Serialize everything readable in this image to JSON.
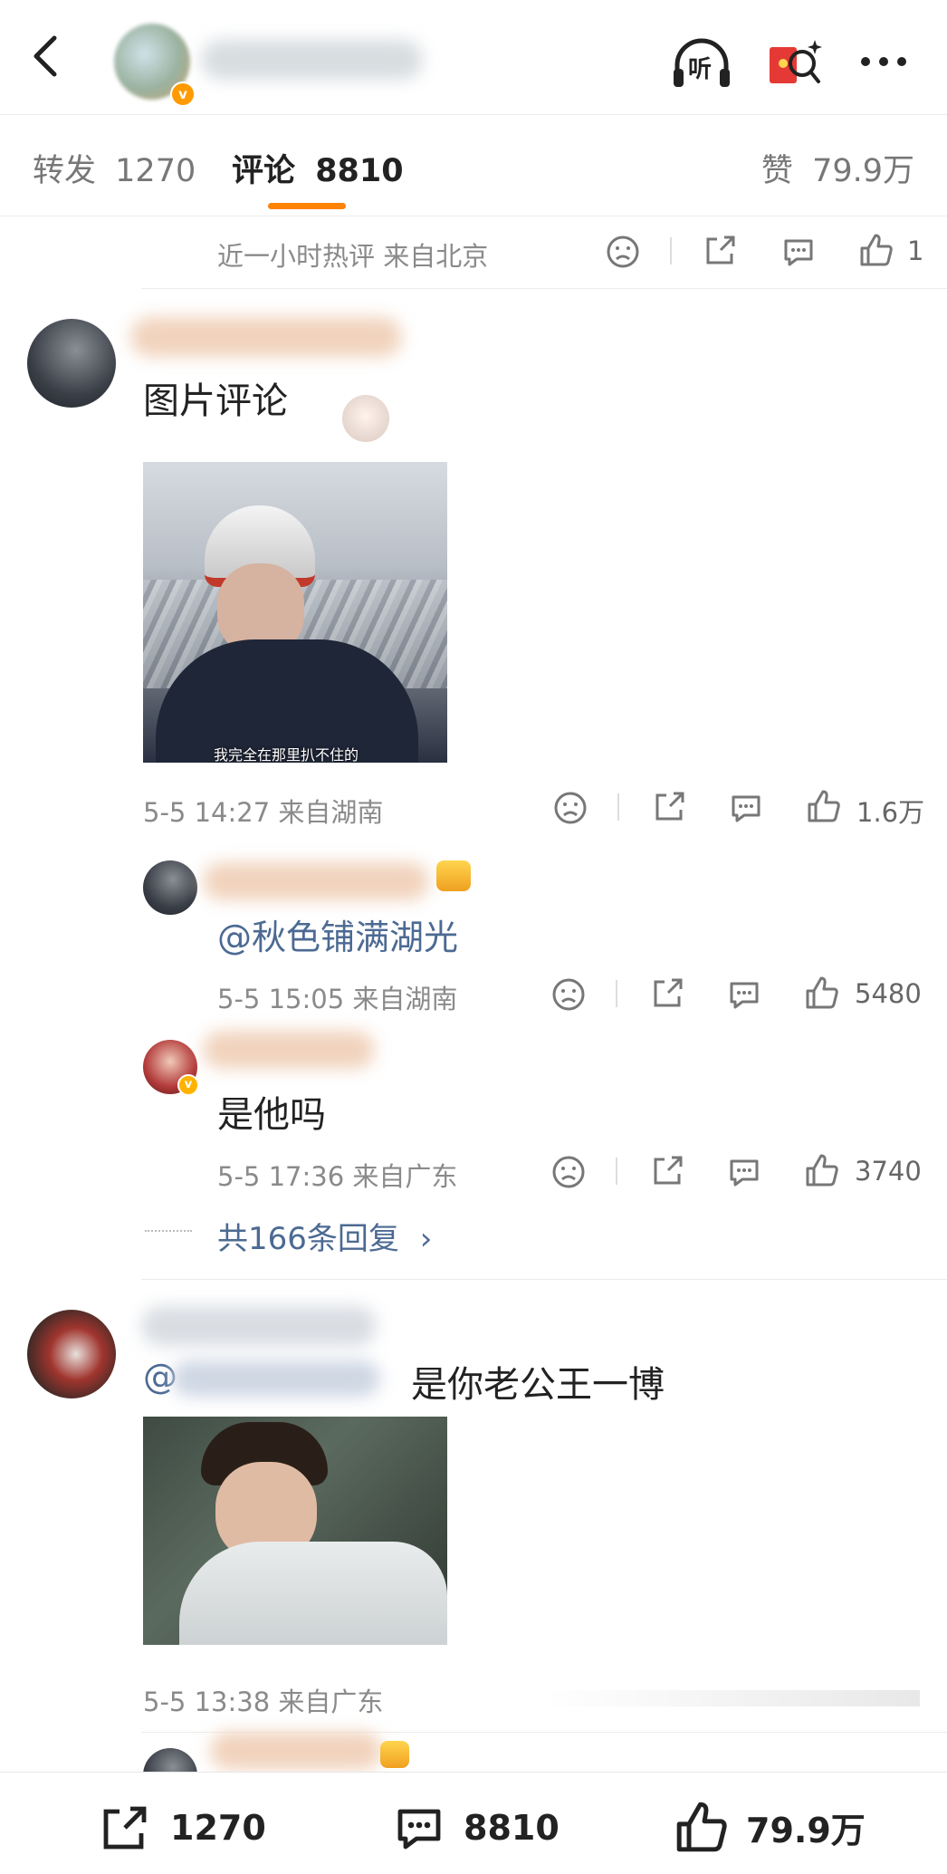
{
  "header": {
    "back_icon": "chevron-left-icon",
    "listen_label": "听",
    "more_icon": "more-dots-icon"
  },
  "tabs": {
    "repost": {
      "label": "转发",
      "count": "1270"
    },
    "comments": {
      "label": "评论",
      "count": "8810"
    },
    "likes": {
      "label": "赞",
      "count": "79.9万"
    }
  },
  "top_item": {
    "meta": "近一小时热评  来自北京",
    "like_count": "1"
  },
  "comments": [
    {
      "text": "图片评论",
      "image_caption": "我完全在那里扒不住的",
      "meta": "5-5 14:27  来自湖南",
      "like_count": "1.6万",
      "replies": [
        {
          "mention": "@秋色铺满湖光",
          "meta": "5-5 15:05  来自湖南",
          "like_count": "5480"
        },
        {
          "text": "是他吗",
          "meta": "5-5 17:36  来自广东",
          "like_count": "3740"
        }
      ],
      "more_replies": "共166条回复",
      "more_replies_chevron": "›"
    },
    {
      "mention_prefix": "@",
      "text": "是你老公王一博",
      "meta": "5-5 13:38  来自广东"
    }
  ],
  "bottom_bar": {
    "repost_count": "1270",
    "comment_count": "8810",
    "like_count": "79.9万"
  },
  "colors": {
    "accent_orange": "#ff8200",
    "link_blue": "#4c6a93",
    "meta_gray": "#8a8a8a"
  }
}
